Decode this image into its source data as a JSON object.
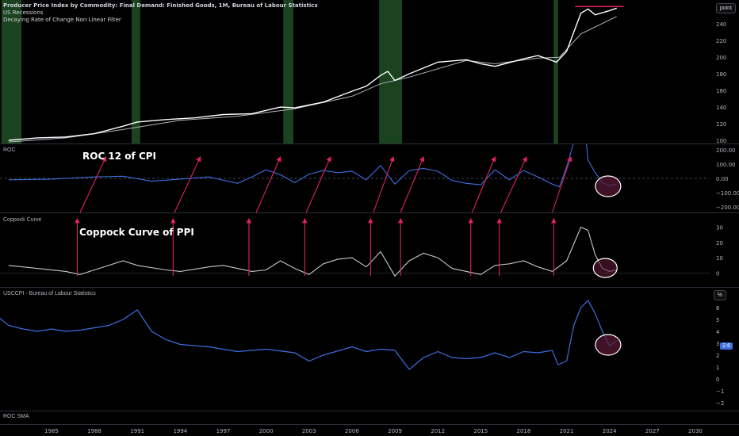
{
  "legend": {
    "title": "Producer Price Index by Commodity: Final Demand: Finished Goods, 1M, Bureau of Labour Statistics",
    "line2": "US Recessions",
    "line3": "Decaying Rate of Change Non Linear Filter"
  },
  "panes": {
    "roc": {
      "label": "ROC",
      "annotation": "ROC 12 of CPI"
    },
    "coppock": {
      "label": "Coppock Curve",
      "annotation": "Coppock Curve of PPI"
    },
    "usccpi": {
      "label": "USCCPI - Bureau of Labour Statistics",
      "price_tag": "2.6"
    },
    "rocsma": {
      "label": "ROC SMA"
    }
  },
  "axis_chips": {
    "top": "point",
    "cpi": "%"
  },
  "colors": {
    "background": "#000000",
    "recession": "#1e4a22",
    "ppi_line": "#ffffff",
    "filter_line": "#b2b5be",
    "roc_line": "#3d6fe0",
    "coppock_line": "#c8c8c8",
    "cpi_line": "#3d6fe0",
    "arrows": "#e0225e",
    "highlight_fill": "#5a1a36",
    "divider": "#2a2e39",
    "text": "#b2b5be"
  },
  "chart_data": [
    {
      "type": "line",
      "pane": "main",
      "yticks": [
        "100",
        "120",
        "140",
        "160",
        "180",
        "200",
        "220",
        "240"
      ],
      "ylim": [
        100,
        265
      ],
      "recessions": [
        [
          1980.0,
          1980.5
        ],
        [
          1981.5,
          1982.9
        ],
        [
          1990.6,
          1991.2
        ],
        [
          2001.2,
          2001.9
        ],
        [
          2007.9,
          2009.5
        ],
        [
          2020.1,
          2020.4
        ]
      ],
      "series": [
        {
          "values_x": [
            1982,
            1984,
            1986,
            1988,
            1990,
            1991,
            1993,
            1995,
            1997,
            1999,
            2001,
            2002,
            2004,
            2006,
            2007,
            2008,
            2008.5,
            2009,
            2010,
            2012,
            2014,
            2015,
            2016,
            2018,
            2019,
            2020.3,
            2021,
            2022,
            2022.5,
            2023,
            2024,
            2024.5
          ],
          "values": [
            100,
            103,
            104,
            108,
            117,
            122,
            125,
            127,
            131,
            132,
            140,
            139,
            146,
            159,
            165,
            178,
            183,
            172,
            180,
            194,
            197,
            192,
            189,
            198,
            202,
            194,
            207,
            253,
            258,
            251,
            256,
            259
          ]
        },
        {
          "values_x": [
            1982,
            1986,
            1990,
            1994,
            1998,
            2002,
            2006,
            2008,
            2010,
            2014,
            2016,
            2019,
            2020.5,
            2022,
            2024.5
          ],
          "values": [
            98,
            103,
            113,
            124,
            129,
            138,
            153,
            168,
            176,
            196,
            192,
            199,
            200,
            228,
            249
          ]
        }
      ],
      "resistance_level": 261
    },
    {
      "type": "line",
      "pane": "roc",
      "yticks": [
        "200.00",
        "100.00",
        "0.00",
        "−100.00",
        "−200.00"
      ],
      "ylim": [
        -200,
        200
      ],
      "values_x": [
        1982,
        1985,
        1988,
        1990,
        1992,
        1994,
        1996,
        1998,
        1999,
        2000,
        2001,
        2002,
        2003,
        2004,
        2005,
        2006,
        2007,
        2008,
        2009,
        2010,
        2011,
        2012,
        2013,
        2014,
        2015,
        2016,
        2017,
        2018,
        2019,
        2020,
        2020.5,
        2021,
        2021.5,
        2022,
        2022.5,
        2023,
        2023.5,
        2024,
        2024.5
      ],
      "values": [
        -10,
        -5,
        10,
        15,
        -20,
        -5,
        10,
        -35,
        10,
        60,
        25,
        -30,
        30,
        55,
        40,
        50,
        -10,
        90,
        -40,
        55,
        70,
        50,
        -15,
        -35,
        -45,
        60,
        -10,
        55,
        10,
        -40,
        -60,
        80,
        250,
        600,
        130,
        40,
        -30,
        -50,
        -40
      ]
    },
    {
      "type": "line",
      "pane": "coppock",
      "yticks": [
        "30",
        "20",
        "10",
        "0"
      ],
      "ylim": [
        -5,
        35
      ],
      "values_x": [
        1982,
        1984,
        1986,
        1987,
        1988,
        1990,
        1991,
        1993,
        1994,
        1996,
        1997,
        1999,
        2000,
        2001,
        2002,
        2003,
        2004,
        2005,
        2006,
        2007,
        2008,
        2009,
        2010,
        2011,
        2012,
        2013,
        2014,
        2015,
        2016,
        2017,
        2018,
        2019,
        2020,
        2021,
        2022,
        2022.5,
        2023,
        2023.5,
        2024,
        2024.5
      ],
      "values": [
        5,
        3,
        1,
        -1,
        2,
        8,
        5,
        2,
        1,
        4,
        5,
        1,
        2,
        8,
        3,
        -1,
        6,
        9,
        10,
        4,
        14,
        -2,
        8,
        13,
        10,
        3,
        1,
        -1,
        5,
        6,
        8,
        4,
        1,
        8,
        30,
        28,
        12,
        3,
        1,
        2
      ]
    },
    {
      "type": "line",
      "pane": "usccpi",
      "yticks": [
        "6",
        "5",
        "4",
        "3",
        "2",
        "1",
        "0",
        "−1",
        "−2"
      ],
      "ylim": [
        -2,
        7
      ],
      "values_x": [
        1980,
        1981,
        1982,
        1983,
        1984,
        1985,
        1986,
        1987,
        1988,
        1989,
        1990,
        1991,
        1992,
        1993,
        1994,
        1996,
        1998,
        2000,
        2002,
        2003,
        2004,
        2006,
        2007,
        2008,
        2009,
        2010,
        2011,
        2012,
        2013,
        2014,
        2015,
        2016,
        2017,
        2018,
        2019,
        2020,
        2020.4,
        2021,
        2021.5,
        2022,
        2022.5,
        2023,
        2023.5,
        2024,
        2024.5
      ],
      "values": [
        6,
        5.5,
        4.5,
        4.2,
        4.0,
        4.2,
        4.0,
        4.1,
        4.3,
        4.5,
        5.0,
        5.8,
        4.0,
        3.3,
        2.9,
        2.7,
        2.3,
        2.5,
        2.2,
        1.5,
        2.0,
        2.7,
        2.3,
        2.5,
        2.4,
        0.8,
        1.8,
        2.3,
        1.8,
        1.7,
        1.8,
        2.2,
        1.8,
        2.3,
        2.2,
        2.4,
        1.2,
        1.5,
        4.5,
        6.0,
        6.6,
        5.5,
        4.0,
        2.8,
        3.2
      ]
    },
    {
      "type": "line",
      "pane": "rocsma",
      "values_x": [],
      "values": []
    }
  ],
  "xaxis": {
    "labels": [
      "1985",
      "1988",
      "1991",
      "1994",
      "1997",
      "2000",
      "2003",
      "2006",
      "2009",
      "2012",
      "2015",
      "2018",
      "2021",
      "2024",
      "2027",
      "2030"
    ],
    "start": 1983,
    "end": 2031
  }
}
